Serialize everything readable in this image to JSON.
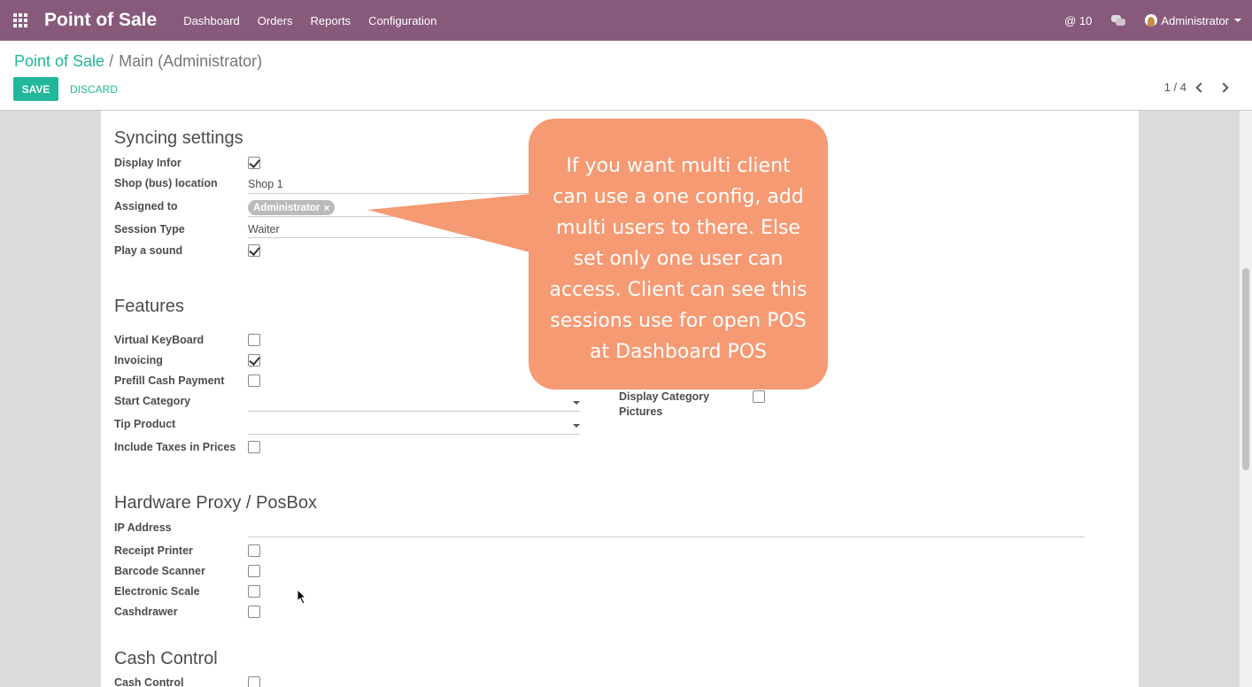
{
  "navbar": {
    "brand": "Point of Sale",
    "menu": [
      "Dashboard",
      "Orders",
      "Reports",
      "Configuration"
    ],
    "mentions": "@ 10",
    "user": "Administrator"
  },
  "control_panel": {
    "breadcrumb_root": "Point of Sale",
    "breadcrumb_sep": "/",
    "breadcrumb_current": "Main (Administrator)",
    "save_label": "SAVE",
    "discard_label": "DISCARD",
    "pager": "1 / 4"
  },
  "syncing": {
    "title": "Syncing settings",
    "display_infor_label": "Display Infor",
    "shop_label": "Shop (bus) location",
    "shop_value": "Shop 1",
    "assigned_label": "Assigned to",
    "assigned_tag": "Administrator",
    "assigned_tag_remove": "×",
    "session_type_label": "Session Type",
    "session_type_value": "Waiter",
    "play_sound_label": "Play a sound"
  },
  "features": {
    "title": "Features",
    "virtual_keyboard_label": "Virtual KeyBoard",
    "invoicing_label": "Invoicing",
    "prefill_label": "Prefill Cash Payment",
    "start_category_label": "Start Category",
    "tip_product_label": "Tip Product",
    "include_taxes_label": "Include Taxes in Prices",
    "display_category_label_1": "Display Category",
    "display_category_label_2": "Pictures"
  },
  "hardware": {
    "title": "Hardware Proxy / PosBox",
    "ip_label": "IP Address",
    "receipt_printer_label": "Receipt Printer",
    "barcode_scanner_label": "Barcode Scanner",
    "electronic_scale_label": "Electronic Scale",
    "cashdrawer_label": "Cashdrawer"
  },
  "cash_control": {
    "title": "Cash Control",
    "cash_control_label": "Cash Control"
  },
  "callout": {
    "text": "If you want multi client can use a one config, add multi users to there. Else set only one user can access. Client can see this sessions use for open POS at Dashboard POS"
  },
  "colors": {
    "navbar": "#875a7b",
    "accent": "#21b799",
    "callout": "#f59a73"
  }
}
